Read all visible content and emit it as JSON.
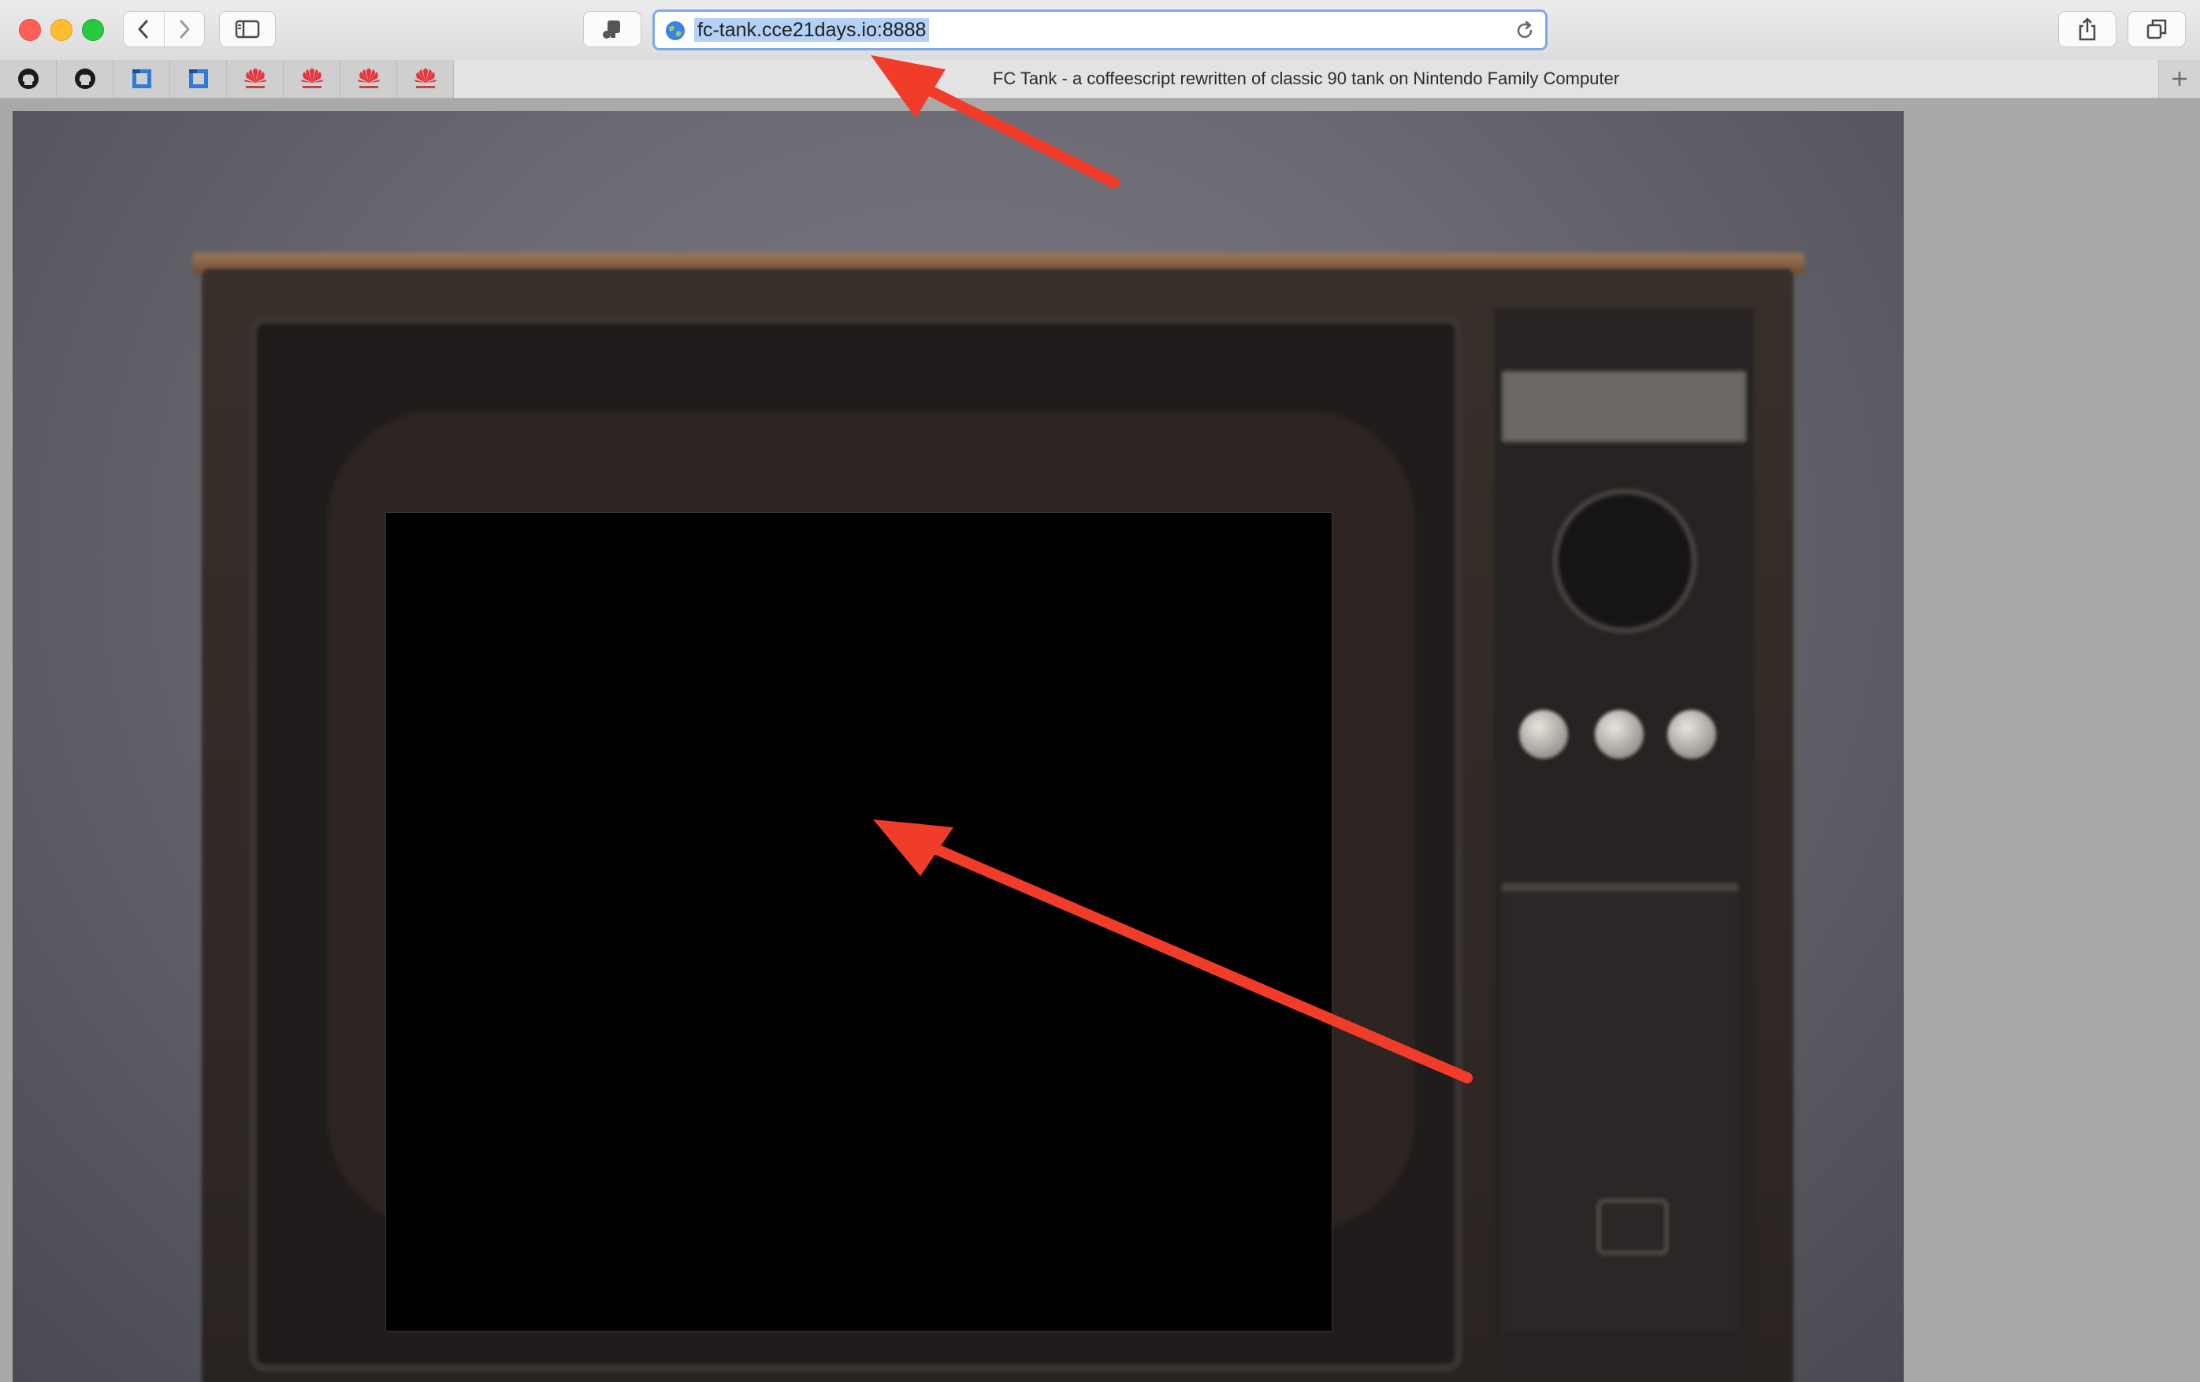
{
  "browser": {
    "url": "fc-tank.cce21days.io:8888",
    "tab_title": "FC Tank - a coffeescript rewritten of classic 90 tank on Nintendo Family Computer"
  },
  "favorites": [
    {
      "icon": "github-icon"
    },
    {
      "icon": "github-icon"
    },
    {
      "icon": "square-logo-icon"
    },
    {
      "icon": "square-logo-icon"
    },
    {
      "icon": "huawei-icon"
    },
    {
      "icon": "huawei-icon"
    },
    {
      "icon": "huawei-icon"
    },
    {
      "icon": "huawei-icon"
    }
  ],
  "colors": {
    "arrow": "#f23c2a",
    "url_highlight": "#b3d0f7",
    "canvas": "#000000"
  }
}
